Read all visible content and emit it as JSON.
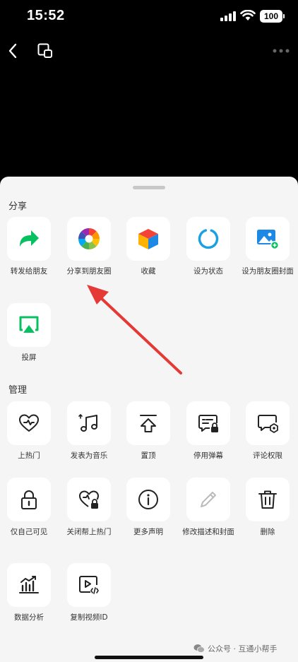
{
  "status_bar": {
    "time": "15:52",
    "battery": "100"
  },
  "sections": {
    "share": "分享",
    "manage": "管理"
  },
  "share_items": [
    {
      "label": "转发给朋友",
      "icon": "forward-arrow-icon"
    },
    {
      "label": "分享到朋友圈",
      "icon": "moments-aperture-icon"
    },
    {
      "label": "收藏",
      "icon": "favorites-cube-icon"
    },
    {
      "label": "设为状态",
      "icon": "status-ring-icon"
    },
    {
      "label": "设为朋友圈封面",
      "icon": "image-cover-icon"
    },
    {
      "label": "投屏",
      "icon": "screen-cast-icon"
    }
  ],
  "manage_items": [
    {
      "label": "上热门",
      "icon": "heart-boost-icon"
    },
    {
      "label": "发表为音乐",
      "icon": "music-note-icon"
    },
    {
      "label": "置顶",
      "icon": "pin-top-icon"
    },
    {
      "label": "停用弹幕",
      "icon": "danmaku-off-icon"
    },
    {
      "label": "评论权限",
      "icon": "comment-permission-icon"
    },
    {
      "label": "仅自己可见",
      "icon": "lock-icon"
    },
    {
      "label": "关闭帮上热门",
      "icon": "heart-lock-icon"
    },
    {
      "label": "更多声明",
      "icon": "info-icon"
    },
    {
      "label": "修改描述和封面",
      "icon": "pencil-icon"
    },
    {
      "label": "删除",
      "icon": "trash-icon"
    },
    {
      "label": "数据分析",
      "icon": "chart-analysis-icon"
    },
    {
      "label": "复制视频ID",
      "icon": "video-code-icon"
    }
  ],
  "watermark": "公众号 · 互通小帮手",
  "colors": {
    "wechat_green": "#07c160",
    "annotation_red": "#e53935",
    "disabled_gray": "#bbbbbb"
  }
}
